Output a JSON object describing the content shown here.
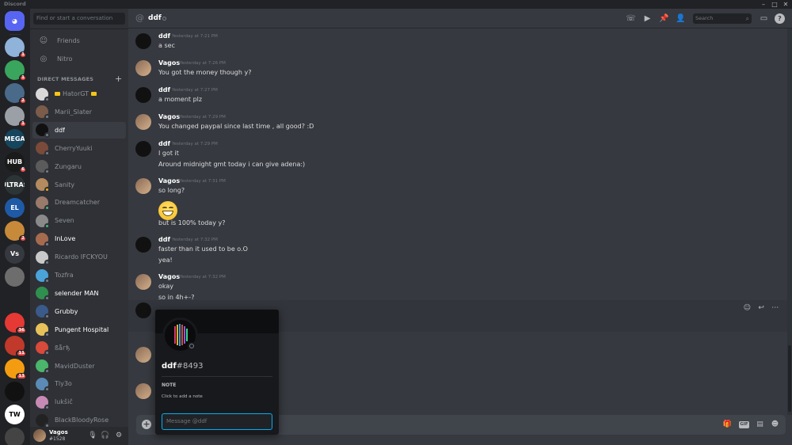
{
  "app": {
    "title": "Discord"
  },
  "guilds": [
    {
      "color": "#5865f2",
      "label": "",
      "badge": ""
    },
    {
      "color": "#8fb3d9",
      "label": "",
      "badge": "1"
    },
    {
      "color": "#3aa55c",
      "label": "",
      "badge": "1"
    },
    {
      "color": "#4a6a8a",
      "label": "",
      "badge": "2"
    },
    {
      "color": "#9aa0a6",
      "label": "",
      "badge": "1"
    },
    {
      "color": "#16455e",
      "label": "MEGA",
      "badge": ""
    },
    {
      "color": "#1a1a1a",
      "label": "HUB",
      "badge": "6"
    },
    {
      "color": "#2d3436",
      "label": "ULTRAS",
      "badge": ""
    },
    {
      "color": "#1f5aa6",
      "label": "EL",
      "badge": ""
    },
    {
      "color": "#c78a3a",
      "label": "",
      "badge": "2"
    },
    {
      "color": "#36393f",
      "label": "Vs",
      "badge": ""
    },
    {
      "color": "#6d6d6d",
      "label": "",
      "badge": ""
    },
    {
      "color": "#202225",
      "label": "",
      "badge": ""
    },
    {
      "color": "#e53935",
      "label": "",
      "badge": "36"
    },
    {
      "color": "#c0392b",
      "label": "",
      "badge": "11"
    },
    {
      "color": "#f39c12",
      "label": "",
      "badge": "13"
    },
    {
      "color": "#111111",
      "label": "",
      "badge": ""
    },
    {
      "color": "#ffffff",
      "label": "TW",
      "badge": ""
    },
    {
      "color": "#444444",
      "label": "",
      "badge": ""
    }
  ],
  "sidebar": {
    "search_placeholder": "Find or start a conversation",
    "friends_label": "Friends",
    "nitro_label": "Nitro",
    "dm_header": "DIRECT MESSAGES",
    "dm_add": "+",
    "dms": [
      {
        "name": "HatorGT",
        "status_color": "#747f8d",
        "bright": false,
        "selected": false,
        "avatar": "#d9d9d9",
        "tags": true
      },
      {
        "name": "Marii_Slater",
        "status_color": "#747f8d",
        "bright": false,
        "selected": false,
        "avatar": "#7b5b4a",
        "tags": false
      },
      {
        "name": "ddf",
        "status_color": "#747f8d",
        "bright": true,
        "selected": true,
        "avatar": "#111111",
        "tags": false
      },
      {
        "name": "CherryYuuki",
        "status_color": "#747f8d",
        "bright": false,
        "selected": false,
        "avatar": "#7a4a3a",
        "tags": false
      },
      {
        "name": "Zungaru",
        "status_color": "#747f8d",
        "bright": false,
        "selected": false,
        "avatar": "#5b5b5b",
        "tags": false
      },
      {
        "name": "Sanity",
        "status_color": "#faa61a",
        "bright": false,
        "selected": false,
        "avatar": "#b38b5e",
        "tags": false
      },
      {
        "name": "Dreamcatcher",
        "status_color": "#43b581",
        "bright": false,
        "selected": false,
        "avatar": "#9a7a6a",
        "tags": false
      },
      {
        "name": "Seven",
        "status_color": "#43b581",
        "bright": false,
        "selected": false,
        "avatar": "#8a8a8a",
        "tags": false
      },
      {
        "name": "InLove",
        "status_color": "#747f8d",
        "bright": true,
        "selected": false,
        "avatar": "#a66b4f",
        "tags": false
      },
      {
        "name": "Ricardo IFCKYOU",
        "status_color": "#747f8d",
        "bright": false,
        "selected": false,
        "avatar": "#c9c9c9",
        "tags": false
      },
      {
        "name": "Tozfra",
        "status_color": "#747f8d",
        "bright": false,
        "selected": false,
        "avatar": "#4aa3d9",
        "tags": false
      },
      {
        "name": "selender MAN",
        "status_color": "#747f8d",
        "bright": true,
        "selected": false,
        "avatar": "#2f8f4e",
        "tags": false
      },
      {
        "name": "Grubby",
        "status_color": "#747f8d",
        "bright": true,
        "selected": false,
        "avatar": "#3a5a8a",
        "tags": false
      },
      {
        "name": "Pungent Hospital",
        "status_color": "#747f8d",
        "bright": true,
        "selected": false,
        "avatar": "#e8c15a",
        "tags": false
      },
      {
        "name": "ßẫгђ",
        "status_color": "#747f8d",
        "bright": false,
        "selected": false,
        "avatar": "#d84a3a",
        "tags": false
      },
      {
        "name": "MavidDuster",
        "status_color": "#747f8d",
        "bright": false,
        "selected": false,
        "avatar": "#4ab56b",
        "tags": false
      },
      {
        "name": "Tly3o",
        "status_color": "#747f8d",
        "bright": false,
        "selected": false,
        "avatar": "#5a8ab5",
        "tags": false
      },
      {
        "name": "lukšič",
        "status_color": "#747f8d",
        "bright": false,
        "selected": false,
        "avatar": "#c78ab5",
        "tags": false
      },
      {
        "name": "BlackBloodyRose",
        "status_color": "#747f8d",
        "bright": false,
        "selected": false,
        "avatar": "#222222",
        "tags": false
      }
    ]
  },
  "user": {
    "name": "Vagos",
    "discriminator": "#1528"
  },
  "header": {
    "channel_name": "ddf",
    "search_placeholder": "Search"
  },
  "messages": [
    {
      "author": "ddf",
      "time": "Yesterday at 7:21 PM",
      "lines": [
        "a sec"
      ]
    },
    {
      "author": "Vagos",
      "time": "Yesterday at 7:26 PM",
      "lines": [
        "You got the money though y?"
      ]
    },
    {
      "author": "ddf",
      "time": "Yesterday at 7:27 PM",
      "lines": [
        "a moment plz"
      ]
    },
    {
      "author": "Vagos",
      "time": "Yesterday at 7:29 PM",
      "lines": [
        "You changed paypal since last time , all good? :D"
      ]
    },
    {
      "author": "ddf",
      "time": "Yesterday at 7:29 PM",
      "lines": [
        "I  got it",
        "Around midnight gmt today i can give adena:)"
      ]
    },
    {
      "author": "Vagos",
      "time": "Yesterday at 7:31 PM",
      "lines": [
        "so long?",
        "",
        "but is 100% today y?"
      ]
    },
    {
      "author": "ddf",
      "time": "Yesterday at 7:32 PM",
      "lines": [
        "faster than it used to be o.O",
        "yea!"
      ]
    },
    {
      "author": "Vagos",
      "time": "Yesterday at 7:32 PM",
      "lines": [
        "okay",
        "so in 4h+-?"
      ]
    }
  ],
  "composer": {
    "gif_label": "GIF"
  },
  "profile": {
    "username": "ddf",
    "discriminator": "#8493",
    "note_label": "NOTE",
    "note_hint": "Click to add a note",
    "message_placeholder": "Message @ddf"
  }
}
